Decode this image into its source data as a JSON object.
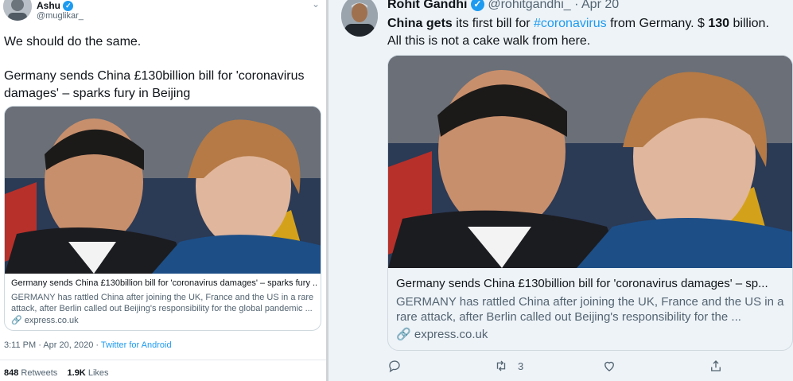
{
  "left_tweet": {
    "author_name": "Ashu",
    "author_handle": "@muglikar_",
    "text_line1": "We should do the same.",
    "text_line2": "Germany sends China £130billion bill for 'coronavirus damages' – sparks fury in Beijing",
    "card": {
      "title": "Germany sends China £130billion bill for 'coronavirus damages' – sparks fury ...",
      "description": "GERMANY has rattled China after joining the UK, France and the US in a rare attack, after Berlin called out Beijing's responsibility for the global pandemic ...",
      "domain": "express.co.uk"
    },
    "timestamp": "3:11 PM · Apr 20, 2020",
    "source": "Twitter for Android",
    "retweets_count": "848",
    "retweets_label": "Retweets",
    "likes_count": "1.9K",
    "likes_label": "Likes"
  },
  "right_tweet": {
    "author_name": "Rohit Gandhi",
    "author_handle": "@rohitgandhi_",
    "date": "Apr 20",
    "text_bold1": "China gets",
    "text_part2": " its first bill for ",
    "hashtag": "#coronavirus",
    "text_part3": " from Germany. $ ",
    "text_bold2": "130",
    "text_part4": " billion. All this is not a cake walk from here.",
    "card": {
      "title": "Germany sends China £130billion bill for 'coronavirus damages' – sp...",
      "description": "GERMANY has rattled China after joining the UK, France and the US in a rare attack, after Berlin called out Beijing's responsibility for the ...",
      "domain": "express.co.uk"
    },
    "retweet_count": "3"
  },
  "icons": [
    "verified-badge-icon",
    "link-icon",
    "reply-icon",
    "retweet-icon",
    "like-icon",
    "share-icon",
    "more-caret-icon"
  ],
  "colors": {
    "accent": "#1d9bf0",
    "secondary_text": "#536471",
    "right_background": "#eef3f8"
  }
}
